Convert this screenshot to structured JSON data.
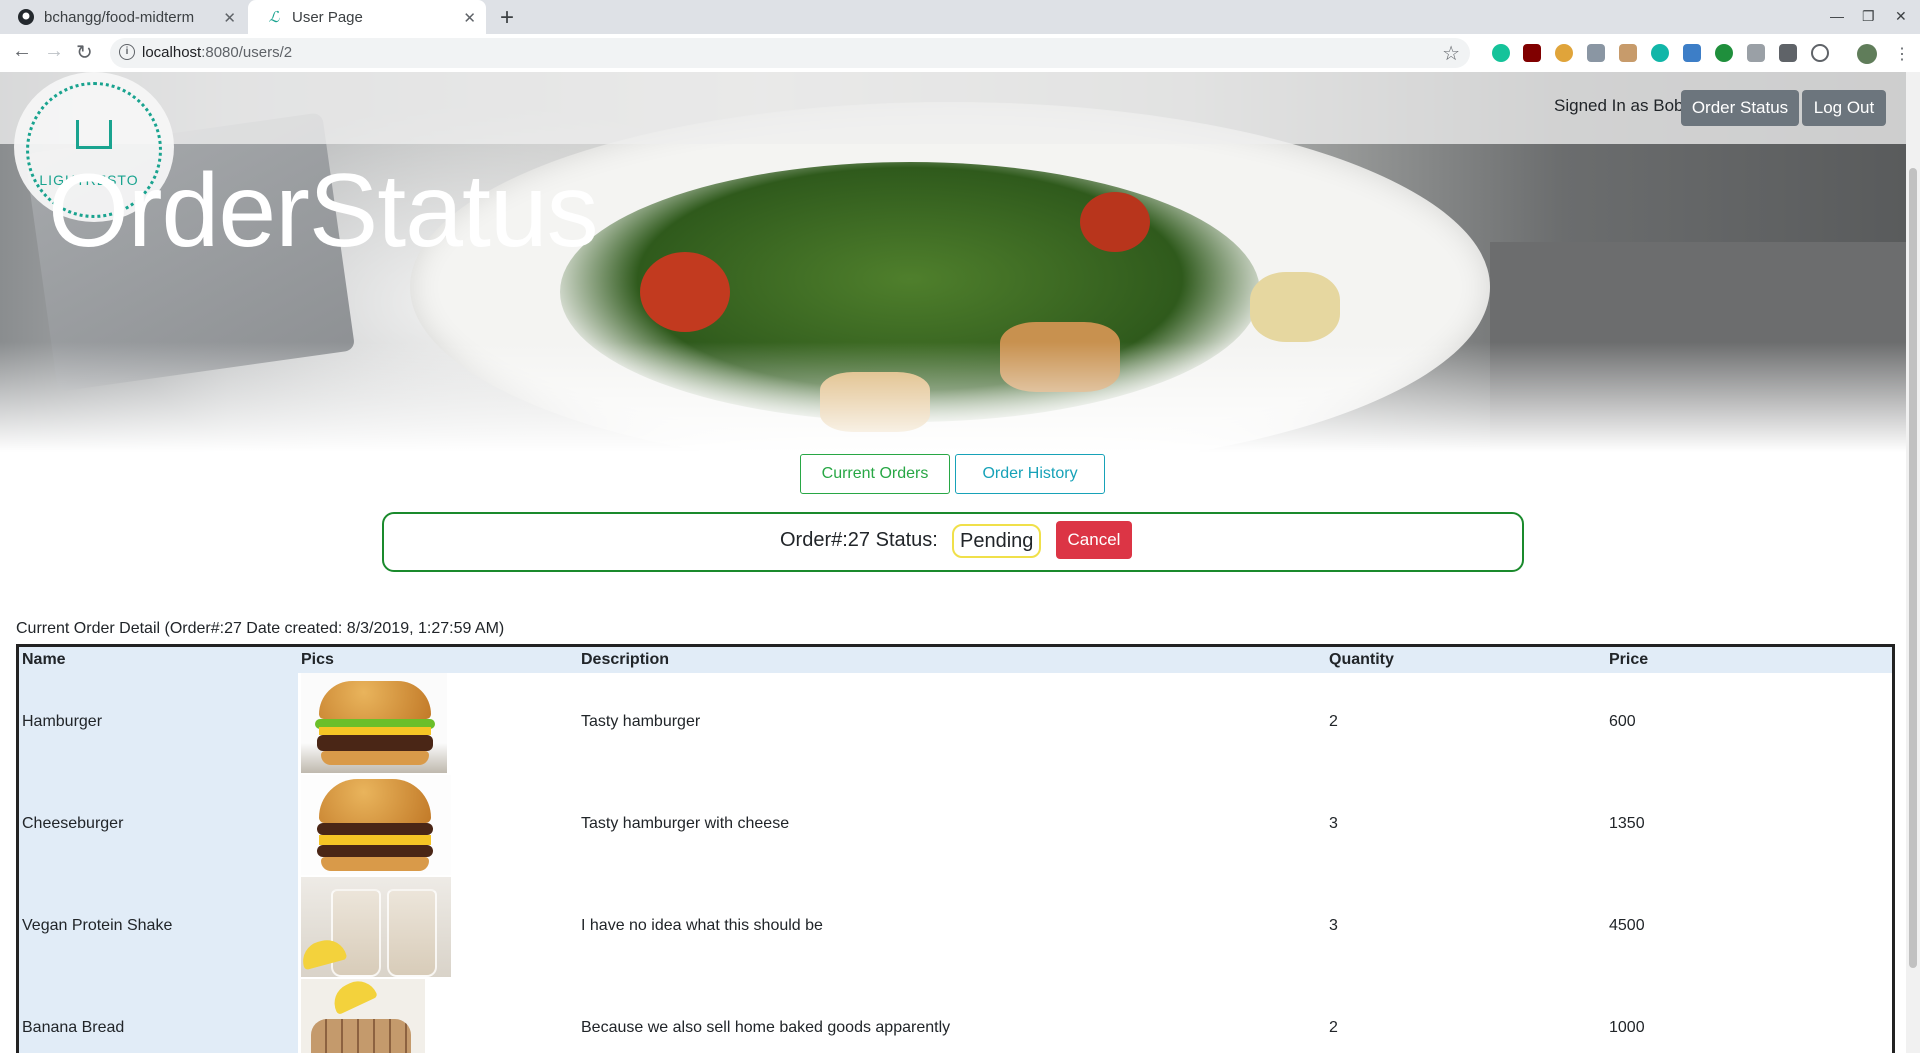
{
  "browser": {
    "tabs": [
      {
        "title": "bchangg/food-midterm",
        "icon": "github-icon"
      },
      {
        "title": "User Page",
        "icon": "lightresto-icon",
        "active": true
      }
    ],
    "url_host": "localhost",
    "url_path": ":8080/users/2"
  },
  "header": {
    "logo_text": "LIGHTRESTO",
    "page_title": "OrderStatus",
    "signed_in": "Signed In as Bob",
    "order_status_button": "Order Status",
    "logout_button": "Log Out"
  },
  "order_tabs": {
    "current": "Current Orders",
    "history": "Order History"
  },
  "status": {
    "label": "Order#:27 Status:",
    "value": "Pending",
    "cancel_button": "Cancel"
  },
  "detail": {
    "caption": "Current Order Detail (Order#:27 Date created: 8/3/2019, 1:27:59 AM)",
    "columns": [
      "Name",
      "Pics",
      "Description",
      "Quantity",
      "Price"
    ],
    "rows": [
      {
        "name": "Hamburger",
        "pic": "hamburger-image",
        "description": "Tasty hamburger",
        "quantity": "2",
        "price": "600"
      },
      {
        "name": "Cheeseburger",
        "pic": "cheeseburger-image",
        "description": "Tasty hamburger with cheese",
        "quantity": "3",
        "price": "1350"
      },
      {
        "name": "Vegan Protein Shake",
        "pic": "protein-shake-image",
        "description": "I have no idea what this should be",
        "quantity": "3",
        "price": "4500"
      },
      {
        "name": "Banana Bread",
        "pic": "banana-bread-image",
        "description": "Because we also sell home baked goods apparently",
        "quantity": "2",
        "price": "1000"
      }
    ]
  },
  "colors": {
    "success": "#28a745",
    "info": "#17a2b8",
    "danger": "#dc3545",
    "secondary": "#6c757d",
    "pending_outline": "#f0e04a",
    "status_border": "#1a8a2c"
  }
}
